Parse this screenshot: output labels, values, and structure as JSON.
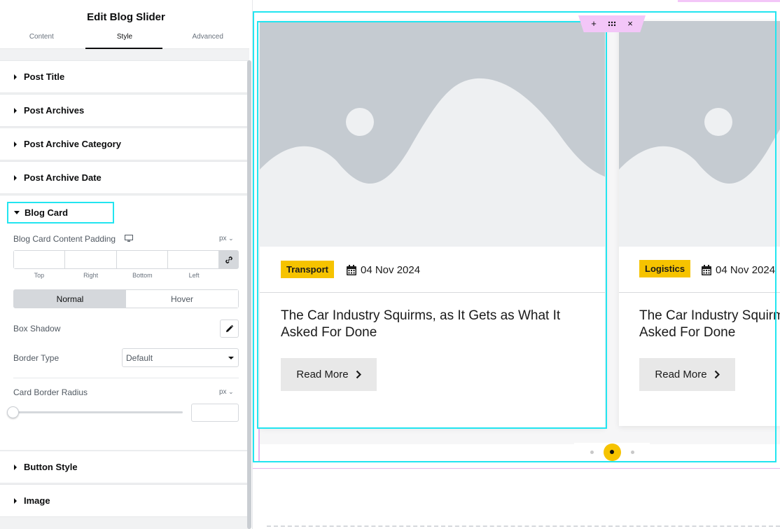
{
  "panel": {
    "title": "Edit Blog Slider",
    "tabs": [
      "Content",
      "Style",
      "Advanced"
    ],
    "active_tab": "Style",
    "sections_top": [
      "Post Title",
      "Post Archives",
      "Post Archive Category",
      "Post Archive Date"
    ],
    "open_section": "Blog Card",
    "sections_bottom": [
      "Button Style",
      "Image"
    ],
    "padding_control": {
      "label": "Blog Card Content Padding",
      "unit": "px",
      "device_icon": "desktop-icon",
      "link_icon": "link-icon",
      "sides": [
        "Top",
        "Right",
        "Bottom",
        "Left"
      ]
    },
    "state_toggle": [
      "Normal",
      "Hover"
    ],
    "active_state": "Normal",
    "box_shadow_label": "Box Shadow",
    "border_type": {
      "label": "Border Type",
      "value": "Default"
    },
    "border_radius": {
      "label": "Card Border Radius",
      "unit": "px",
      "value": 0
    }
  },
  "toolbar": {
    "icons": [
      "plus-icon",
      "drag-handle-icon",
      "close-icon"
    ],
    "add": "+",
    "close": "×"
  },
  "cards": [
    {
      "category": "Transport",
      "date": "04 Nov 2024",
      "title": "The Car Industry Squirms, as It Gets as What It Asked For Done",
      "button": "Read More"
    },
    {
      "category": "Logistics",
      "date": "04 Nov 2024",
      "title": "The Car Industry Squirms, as It Gets as What It Asked For Done",
      "button": "Read More"
    }
  ],
  "pagination": {
    "count": 3,
    "active_index": 1
  },
  "colors": {
    "accent_badge": "#f6c300",
    "selection_outline": "#22e5f0",
    "toolbar_bg": "#f3c6f8",
    "placeholder_image": "#c5cbd1"
  }
}
